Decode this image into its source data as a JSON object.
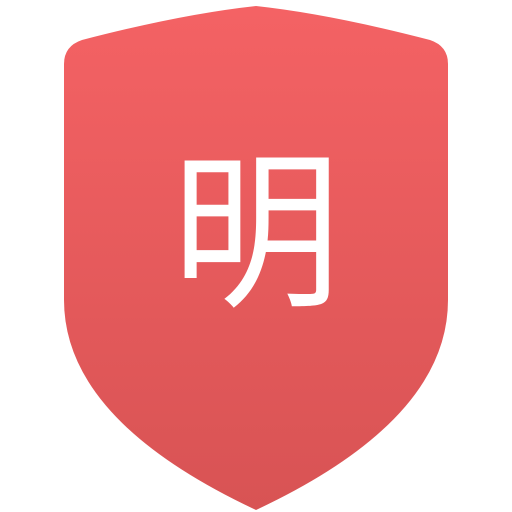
{
  "icon": {
    "name": "shield-icon",
    "glyph": "明",
    "colors": {
      "top": "#F46264",
      "bottom": "#D85354",
      "glyph": "#FFFFFF",
      "background": "#FFFFFF"
    }
  }
}
